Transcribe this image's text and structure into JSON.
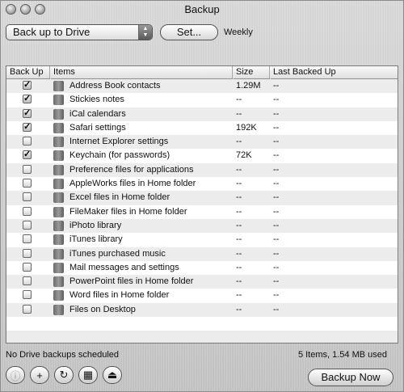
{
  "window": {
    "title": "Backup"
  },
  "destination": {
    "selected": "Back up to Drive",
    "set_label": "Set...",
    "schedule": "Weekly"
  },
  "table": {
    "columns": [
      "Back Up",
      "Items",
      "Size",
      "Last Backed Up"
    ],
    "rows": [
      {
        "checked": true,
        "name": "Address Book contacts",
        "size": "1.29M",
        "last": "--"
      },
      {
        "checked": true,
        "name": "Stickies notes",
        "size": "--",
        "last": "--"
      },
      {
        "checked": true,
        "name": "iCal calendars",
        "size": "--",
        "last": "--"
      },
      {
        "checked": true,
        "name": "Safari settings",
        "size": "192K",
        "last": "--"
      },
      {
        "checked": false,
        "name": "Internet Explorer settings",
        "size": "--",
        "last": "--"
      },
      {
        "checked": true,
        "name": "Keychain (for passwords)",
        "size": "72K",
        "last": "--"
      },
      {
        "checked": false,
        "name": "Preference files for applications",
        "size": "--",
        "last": "--"
      },
      {
        "checked": false,
        "name": "AppleWorks files in Home folder",
        "size": "--",
        "last": "--"
      },
      {
        "checked": false,
        "name": "Excel files in Home folder",
        "size": "--",
        "last": "--"
      },
      {
        "checked": false,
        "name": "FileMaker files in Home folder",
        "size": "--",
        "last": "--"
      },
      {
        "checked": false,
        "name": "iPhoto library",
        "size": "--",
        "last": "--"
      },
      {
        "checked": false,
        "name": "iTunes library",
        "size": "--",
        "last": "--"
      },
      {
        "checked": false,
        "name": "iTunes purchased music",
        "size": "--",
        "last": "--"
      },
      {
        "checked": false,
        "name": "Mail messages and settings",
        "size": "--",
        "last": "--"
      },
      {
        "checked": false,
        "name": "PowerPoint files in Home folder",
        "size": "--",
        "last": "--"
      },
      {
        "checked": false,
        "name": "Word files in Home folder",
        "size": "--",
        "last": "--"
      },
      {
        "checked": false,
        "name": "Files on Desktop",
        "size": "--",
        "last": "--"
      },
      {
        "checked": false,
        "name": "",
        "size": "",
        "last": ""
      },
      {
        "checked": false,
        "name": "",
        "size": "",
        "last": ""
      }
    ]
  },
  "status": {
    "left": "No Drive backups scheduled",
    "right": "5 Items, 1.54 MB used"
  },
  "buttons": {
    "info_icon": "info-icon",
    "add": "+",
    "refresh_icon": "refresh-icon",
    "calendar_icon": "calendar-icon",
    "eject_icon": "eject-icon",
    "backup_now": "Backup Now"
  }
}
